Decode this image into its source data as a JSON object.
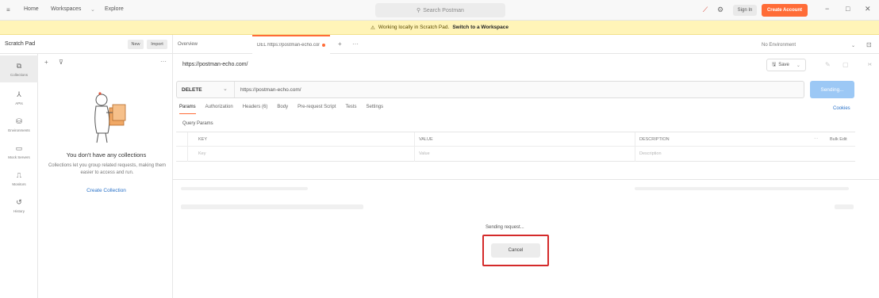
{
  "topbar": {
    "nav": [
      "Home",
      "Workspaces",
      "Explore"
    ],
    "search_placeholder": "Search Postman",
    "sign_in": "Sign In",
    "create_account": "Create Account"
  },
  "banner": {
    "text": "Working locally in Scratch Pad.",
    "link": "Switch to a Workspace"
  },
  "sidebar": {
    "title": "Scratch Pad",
    "new_label": "New",
    "import_label": "Import",
    "rail": [
      "Collections",
      "APIs",
      "Environments",
      "Mock Servers",
      "Monitors",
      "History"
    ],
    "empty_title": "You don't have any collections",
    "empty_desc": "Collections let you group related requests, making them easier to access and run.",
    "create_link": "Create Collection"
  },
  "tabs": {
    "overview": "Overview",
    "active": "DEL https://postman-echo.com/",
    "environment": "No Environment"
  },
  "request": {
    "name": "https://postman-echo.com/",
    "save": "Save",
    "method": "DELETE",
    "url": "https://postman-echo.com/",
    "send": "Sending...",
    "tabs": [
      "Params",
      "Authorization",
      "Headers (6)",
      "Body",
      "Pre-request Script",
      "Tests",
      "Settings"
    ],
    "cookies": "Cookies",
    "query_title": "Query Params",
    "columns": [
      "KEY",
      "VALUE",
      "DESCRIPTION",
      "Bulk Edit"
    ],
    "row": [
      "Key",
      "Value",
      "Description"
    ]
  },
  "response": {
    "status": "Sending request...",
    "cancel": "Cancel"
  },
  "colors": {
    "accent": "#ff6c37",
    "send_disabled": "#9cc8f5",
    "highlight": "#d42a2a",
    "banner": "#fff4b8"
  }
}
